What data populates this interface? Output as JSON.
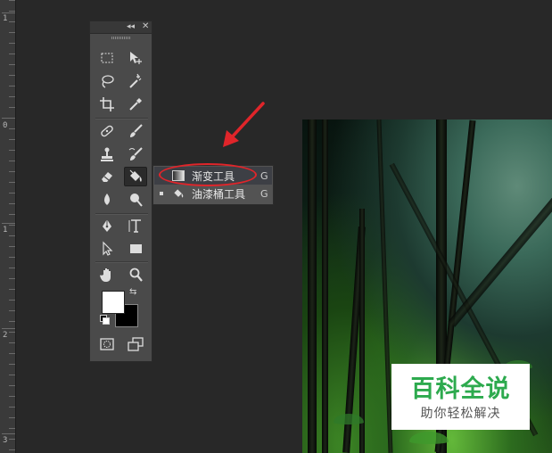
{
  "ruler": {
    "numbers": [
      "1",
      "0",
      "1",
      "2",
      "3"
    ]
  },
  "tools_panel": {
    "collapse_label": "◂◂",
    "close_label": "✕",
    "tools": [
      {
        "name": "rectangular-marquee-tool"
      },
      {
        "name": "move-tool"
      },
      {
        "name": "lasso-tool"
      },
      {
        "name": "magic-wand-tool"
      },
      {
        "name": "crop-tool"
      },
      {
        "name": "eyedropper-tool"
      },
      {
        "name": "spot-healing-brush-tool"
      },
      {
        "name": "brush-tool"
      },
      {
        "name": "clone-stamp-tool"
      },
      {
        "name": "history-brush-tool"
      },
      {
        "name": "eraser-tool"
      },
      {
        "name": "paint-bucket-tool"
      },
      {
        "name": "blur-tool"
      },
      {
        "name": "dodge-tool"
      },
      {
        "name": "pen-tool"
      },
      {
        "name": "horizontal-type-tool"
      },
      {
        "name": "path-selection-tool"
      },
      {
        "name": "rectangle-tool"
      },
      {
        "name": "hand-tool"
      },
      {
        "name": "zoom-tool"
      },
      {
        "name": "quick-mask-tool"
      },
      {
        "name": "screen-mode-tool"
      }
    ],
    "foreground_color": "#ffffff",
    "background_color": "#000000"
  },
  "flyout": {
    "items": [
      {
        "label": "渐变工具",
        "shortcut": "G",
        "icon": "gradient-icon",
        "selected": true
      },
      {
        "label": "油漆桶工具",
        "shortcut": "G",
        "icon": "paint-bucket-icon",
        "selected": false,
        "active_bullet": true
      }
    ]
  },
  "annotation": {
    "arrow_color": "#e0252a",
    "ellipse_color": "#e0252a"
  },
  "watermark": {
    "title": "百科全说",
    "subtitle": "助你轻松解决",
    "color": "#2daa4e"
  }
}
